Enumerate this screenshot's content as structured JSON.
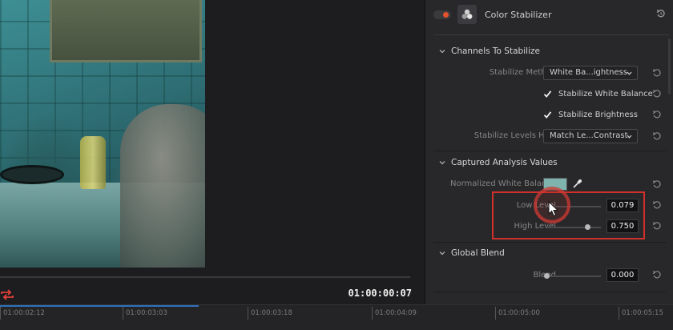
{
  "viewer": {
    "timecode": "01:00:00:07"
  },
  "timeline": {
    "ticks": [
      "01:00:02:12",
      "01:00:03:03",
      "01:00:03:18",
      "01:00:04:09",
      "01:00:05:00",
      "01:00:05:15"
    ]
  },
  "panel": {
    "title": "Color Stabilizer",
    "enabled": true,
    "sections": {
      "channels": {
        "title": "Channels To Stabilize",
        "stabilize_method_label": "Stabilize Method",
        "stabilize_method_value": "White Ba...ightness",
        "white_balance_label": "Stabilize White Balance",
        "white_balance_checked": true,
        "brightness_label": "Stabilize Brightness",
        "brightness_checked": true,
        "levels_how_label": "Stabilize Levels How",
        "levels_how_value": "Match Le...Contrast"
      },
      "captured": {
        "title": "Captured Analysis Values",
        "normalized_wb_label": "Normalized White Balance",
        "normalized_wb_color": "#7fb3ae",
        "low_level_label": "Low Level",
        "low_level_value": "0.079",
        "low_level_fraction": 0.079,
        "high_level_label": "High Level",
        "high_level_value": "0.750",
        "high_level_fraction": 0.75
      },
      "blend": {
        "title": "Global Blend",
        "blend_label": "Blend",
        "blend_value": "0.000",
        "blend_fraction": 0.0
      }
    }
  },
  "colors": {
    "accent_toggle": "#e5522e",
    "highlight": "#d0302a",
    "loop_icon": "#e0413a",
    "progress": "#2f6fbf"
  }
}
